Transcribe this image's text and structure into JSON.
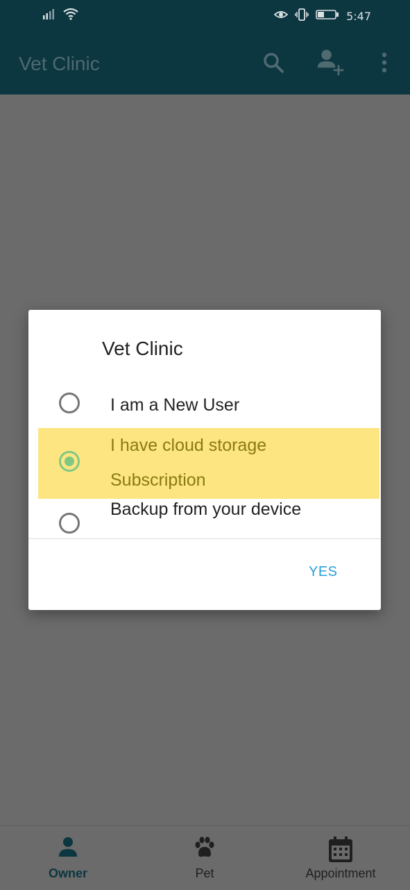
{
  "status_bar": {
    "time": "5:47"
  },
  "app_bar": {
    "title": "Vet Clinic",
    "icons": [
      "search-icon",
      "add-user-icon",
      "more-vert-icon"
    ]
  },
  "dialog": {
    "title": "Vet Clinic",
    "options": [
      {
        "label": "I am a New User",
        "selected": false
      },
      {
        "label_line1": "I have cloud storage",
        "label_line2": "Subscription",
        "selected": true
      },
      {
        "label": "Backup from your device",
        "selected": false
      }
    ],
    "confirm_label": "YES"
  },
  "bottom_nav": {
    "items": [
      {
        "label": "Owner",
        "icon": "person-icon",
        "active": true
      },
      {
        "label": "Pet",
        "icon": "paw-icon",
        "active": false
      },
      {
        "label": "Appointment",
        "icon": "calendar-icon",
        "active": false
      }
    ]
  },
  "colors": {
    "app_bar": "#0c3640",
    "highlight": "#fde682",
    "radio_selected": "#81c784",
    "accent_button": "#26a0d9"
  }
}
